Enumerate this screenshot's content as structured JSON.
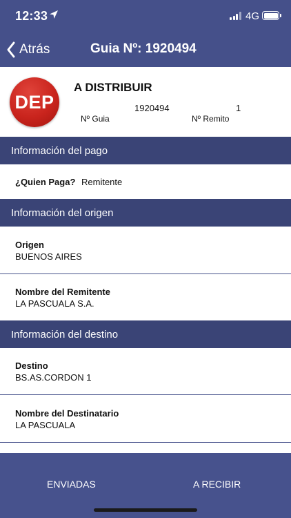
{
  "status_bar": {
    "time": "12:33",
    "network": "4G"
  },
  "nav": {
    "back_label": "Atrás",
    "title": "Guia Nº: 1920494"
  },
  "header": {
    "badge": "DEP",
    "status": "A DISTRIBUIR",
    "guia_value": "1920494",
    "guia_label": "Nº Guia",
    "remito_value": "1",
    "remito_label": "Nº Remito"
  },
  "sections": {
    "pago": {
      "title": "Información del pago",
      "quien_paga_label": "¿Quien Paga?",
      "quien_paga_value": "Remitente"
    },
    "origen": {
      "title": "Información del origen",
      "origen_label": "Origen",
      "origen_value": "BUENOS AIRES",
      "remitente_label": "Nombre del Remitente",
      "remitente_value": "LA PASCUALA S.A."
    },
    "destino": {
      "title": "Información del destino",
      "destino_label": "Destino",
      "destino_value": "BS.AS.CORDON 1",
      "destinatario_label": "Nombre del Destinatario",
      "destinatario_value": "LA PASCUALA"
    }
  },
  "tabs": {
    "enviadas": "ENVIADAS",
    "recibir": "A RECIBIR"
  },
  "colors": {
    "nav_bg": "#45508a",
    "section_bg": "#3a4476",
    "badge_red": "#c9241d"
  }
}
